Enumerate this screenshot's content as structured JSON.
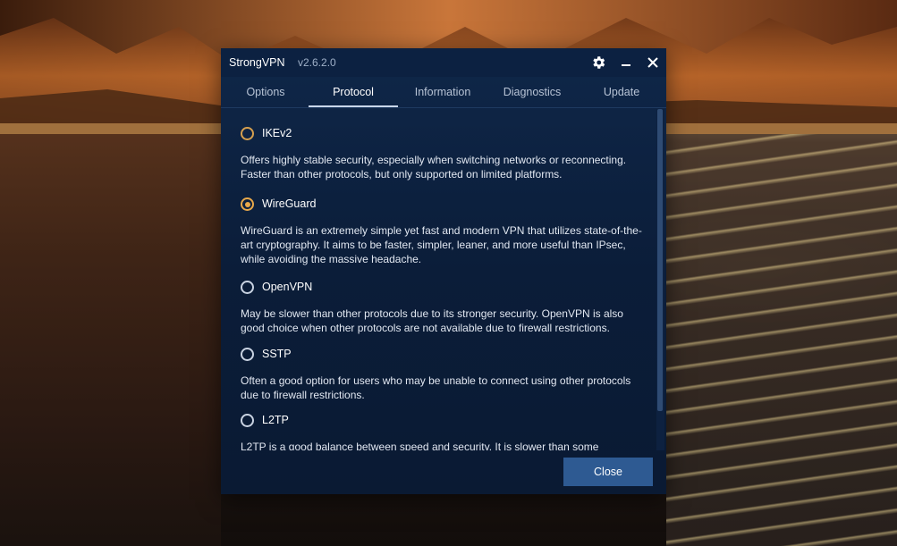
{
  "window": {
    "app_name": "StrongVPN",
    "version": "v2.6.2.0",
    "settings_icon": "gear-icon",
    "minimize_icon": "minimize-icon",
    "close_icon": "close-icon"
  },
  "tabs": [
    {
      "label": "Options",
      "active": false
    },
    {
      "label": "Protocol",
      "active": true
    },
    {
      "label": "Information",
      "active": false
    },
    {
      "label": "Diagnostics",
      "active": false
    },
    {
      "label": "Update",
      "active": false
    }
  ],
  "protocols": [
    {
      "label": "IKEv2",
      "selected": false,
      "description": "Offers highly stable security, especially when switching networks or reconnecting. Faster than other protocols, but only supported on limited platforms."
    },
    {
      "label": "WireGuard",
      "selected": true,
      "description": "WireGuard is an extremely simple yet fast and modern VPN that utilizes state-of-the-art cryptography. It aims to be faster, simpler, leaner, and more useful than IPsec, while avoiding the massive headache."
    },
    {
      "label": "OpenVPN",
      "selected": false,
      "description": "May be slower than other protocols due to its stronger security. OpenVPN is also good choice when other  protocols are not available due to firewall restrictions."
    },
    {
      "label": "SSTP",
      "selected": false,
      "description": "Often a good option for users who may be unable to connect using other protocols due to firewall restrictions."
    },
    {
      "label": "L2TP",
      "selected": false,
      "description": "L2TP is a good balance between speed and security. It is slower than some"
    }
  ],
  "footer": {
    "close_label": "Close"
  },
  "colors": {
    "window_bg": "#0b1d39",
    "accent_radio": "#e8a84a",
    "button_bg": "#2e5a92"
  }
}
